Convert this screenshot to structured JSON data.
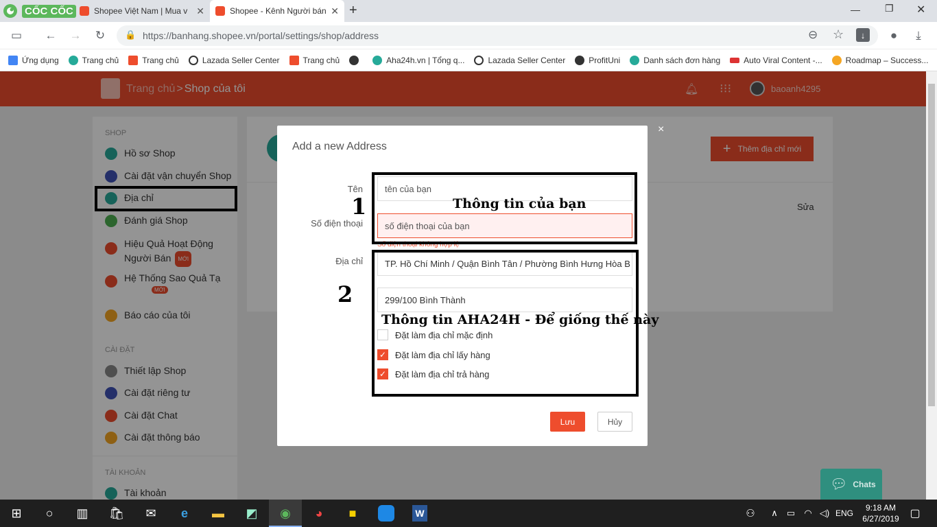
{
  "browser": {
    "brand": "CỐC CỐC",
    "tabs": [
      {
        "title": "Shopee Việt Nam | Mua v"
      },
      {
        "title": "Shopee - Kênh Người bán"
      }
    ],
    "new_tab_icon": "+",
    "url": "https://banhang.shopee.vn/portal/settings/shop/address",
    "bookmarks": [
      {
        "label": "Ứng dụng",
        "color": "#4285f4"
      },
      {
        "label": "Trang chủ",
        "color": "#26aa99"
      },
      {
        "label": "Trang chủ",
        "color": "#ee4d2d"
      },
      {
        "label": "Lazada Seller Center",
        "color": "#333333"
      },
      {
        "label": "Trang chủ",
        "color": "#ee4d2d"
      },
      {
        "label": "",
        "color": "#333333"
      },
      {
        "label": "Aha24h.vn | Tổng q...",
        "color": "#26aa99"
      },
      {
        "label": "Lazada Seller Center",
        "color": "#333333"
      },
      {
        "label": "ProfitUni",
        "color": "#333333"
      },
      {
        "label": "Danh sách đơn hàng",
        "color": "#26aa99"
      },
      {
        "label": "Auto Viral Content -...",
        "color": "#d33"
      },
      {
        "label": "Roadmap – Success...",
        "color": "#f5a623"
      }
    ],
    "bookmarks_more": "»"
  },
  "header": {
    "breadcrumb_home": "Trang chủ",
    "breadcrumb_sep": ">",
    "breadcrumb_current": "Shop của tôi",
    "username": "baoanh4295"
  },
  "sidebar": {
    "sections": [
      {
        "title": "SHOP"
      },
      {
        "title": "CÀI ĐẶT"
      },
      {
        "title": "TÀI KHOẢN"
      }
    ],
    "items": [
      {
        "label": "Hồ sơ Shop",
        "color": "#26aa99"
      },
      {
        "label": "Cài đặt vận chuyển Shop",
        "color": "#3f51b5"
      },
      {
        "label": "Địa chỉ",
        "color": "#26aa99"
      },
      {
        "label": "Đánh giá Shop",
        "color": "#4caf50"
      },
      {
        "label": "Hiệu Quả Hoạt Động Người Bán",
        "color": "#ee4d2d",
        "badge": "MỚI"
      },
      {
        "label": "Hệ Thống Sao Quả Tạ",
        "color": "#ee4d2d",
        "badge": "MỚI"
      },
      {
        "label": "Báo cáo của tôi",
        "color": "#f5a623"
      },
      {
        "label": "Thiết lập Shop",
        "color": "#888888"
      },
      {
        "label": "Cài đặt riêng tư",
        "color": "#3f51b5"
      },
      {
        "label": "Cài đặt Chat",
        "color": "#ee4d2d"
      },
      {
        "label": "Cài đặt thông báo",
        "color": "#f5a623"
      },
      {
        "label": "Tài khoản",
        "color": "#26aa99"
      }
    ]
  },
  "main": {
    "add_button": "Thêm địa chỉ mới",
    "edit_link": "Sửa"
  },
  "modal": {
    "title": "Add a new Address",
    "close": "×",
    "name_label": "Tên",
    "name_placeholder": "tên của bạn",
    "phone_label": "Số điện thoại",
    "phone_placeholder": "số điện thoại của bạn",
    "phone_error": "Số điện thoại không hợp lệ",
    "address_label": "Địa chỉ",
    "address_region": "TP. Hồ Chí Minh / Quận Bình Tân / Phường Bình Hưng Hòa B",
    "address_detail": "299/100 Bình Thành",
    "checkboxes": [
      {
        "label": "Đặt làm địa chỉ mặc định",
        "checked": false
      },
      {
        "label": "Đặt làm địa chỉ lấy hàng",
        "checked": true
      },
      {
        "label": "Đặt làm địa chỉ trả hàng",
        "checked": true
      }
    ],
    "save": "Lưu",
    "cancel": "Hủy"
  },
  "annotations": {
    "num1": "1",
    "text1": "Thông tin của bạn",
    "num2": "2",
    "text2": "Thông tin AHA24H - Để giống thế này"
  },
  "chat": {
    "label": "Chats"
  },
  "taskbar": {
    "language": "ENG",
    "time": "9:18 AM",
    "date": "6/27/2019"
  }
}
